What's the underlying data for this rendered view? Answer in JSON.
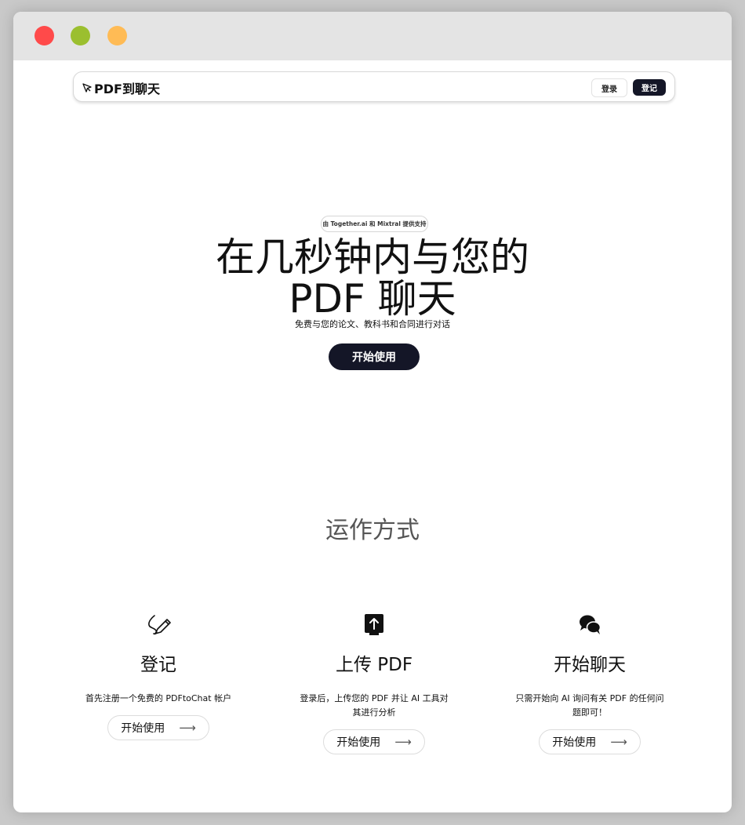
{
  "nav": {
    "brand": "PDF到聊天",
    "login_label": "登录",
    "register_label": "登记"
  },
  "hero": {
    "badge": "由 Together.ai 和 Mixtral 提供支持",
    "title_line1": "在几秒钟内与您的",
    "title_line2": "PDF 聊天",
    "subtitle": "免费与您的论文、教科书和合同进行对话",
    "cta": "开始使用"
  },
  "how": {
    "title": "运作方式",
    "steps": [
      {
        "icon": "pen-icon",
        "title": "登记",
        "desc": "首先注册一个免费的 PDFtoChat 帐户",
        "button": "开始使用"
      },
      {
        "icon": "upload-icon",
        "title": "上传 PDF",
        "desc": "登录后，上传您的 PDF 并让 AI 工具对其进行分析",
        "button": "开始使用"
      },
      {
        "icon": "chat-bubbles-icon",
        "title": "开始聊天",
        "desc": "只需开始向 AI 询问有关 PDF 的任何问题即可！",
        "button": "开始使用"
      }
    ]
  },
  "colors": {
    "primary_dark": "#141627",
    "close": "#ff4a4a",
    "maximize": "#9bbf2f",
    "minimize": "#ffbb55"
  }
}
